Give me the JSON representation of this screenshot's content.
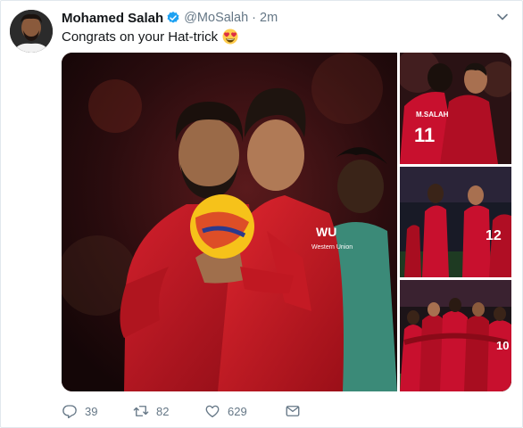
{
  "tweet": {
    "display_name": "Mohamed Salah",
    "handle": "@MoSalah",
    "separator": "·",
    "time": "2m",
    "text": "Congrats on your Hat-trick",
    "emoji": "heart-eyes-emoji",
    "verified": true
  },
  "media": {
    "count": 4,
    "photos": [
      {
        "jersey_text": "Western Union",
        "sleeve_text": "WU"
      },
      {
        "jersey_text": "M.SALAH",
        "number": "11"
      },
      {
        "number": "12"
      },
      {
        "number": "10"
      }
    ]
  },
  "actions": {
    "reply_count": "39",
    "retweet_count": "82",
    "like_count": "629"
  },
  "colors": {
    "text": "#14171a",
    "secondary": "#657786",
    "verified_blue": "#1da1f2",
    "liverpool_red": "#c8102e"
  }
}
